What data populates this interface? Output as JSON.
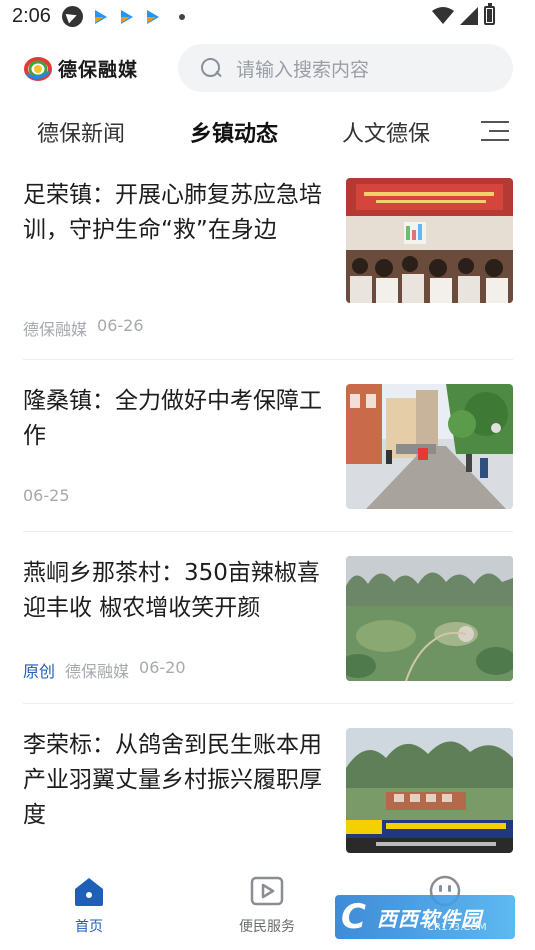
{
  "status_bar": {
    "time": "2:06",
    "icons_left": [
      "telegram-icon",
      "app-arrow-icon",
      "app-arrow-icon",
      "app-arrow-icon",
      "notification-dot-icon"
    ],
    "icons_right": [
      "wifi-icon",
      "signal-icon",
      "battery-charging-icon"
    ]
  },
  "header": {
    "logo_text": "德保融媒",
    "search_placeholder": "请输入搜索内容"
  },
  "tabs": [
    {
      "label": "德保新闻",
      "active": false
    },
    {
      "label": "乡镇动态",
      "active": true
    },
    {
      "label": "人文德保",
      "active": false
    }
  ],
  "news": [
    {
      "title": "足荣镇：开展心肺复苏应急培训，守护生命“救”在身边",
      "tag": "",
      "source": "德保融媒",
      "date": "06-26",
      "thumb": "training-classroom-photo"
    },
    {
      "title": "隆桑镇：全力做好中考保障工作",
      "tag": "",
      "source": "",
      "date": "06-25",
      "thumb": "street-scene-photo"
    },
    {
      "title": "燕峒乡那茶村：350亩辣椒喜迎丰收 椒农增收笑开颜",
      "tag": "原创",
      "source": "德保融媒",
      "date": "06-20",
      "thumb": "karst-valley-aerial-photo"
    },
    {
      "title": "李荣标：从鸽舍到民生账本用产业羽翼丈量乡村振兴履职厚度",
      "tag": "",
      "source": "",
      "date": "",
      "thumb": "mountain-village-aerial-photo"
    }
  ],
  "bottom_nav": [
    {
      "label": "首页",
      "icon": "home-icon",
      "active": true
    },
    {
      "label": "便民服务",
      "icon": "play-icon",
      "active": false
    },
    {
      "label": "",
      "icon": "smiley-icon",
      "active": false
    }
  ],
  "watermark": {
    "main": "西西软件园",
    "sub": "CR173.COM"
  },
  "colors": {
    "accent": "#1e5fb8",
    "meta": "#a6a9ae",
    "search_bg": "#f2f3f5"
  }
}
